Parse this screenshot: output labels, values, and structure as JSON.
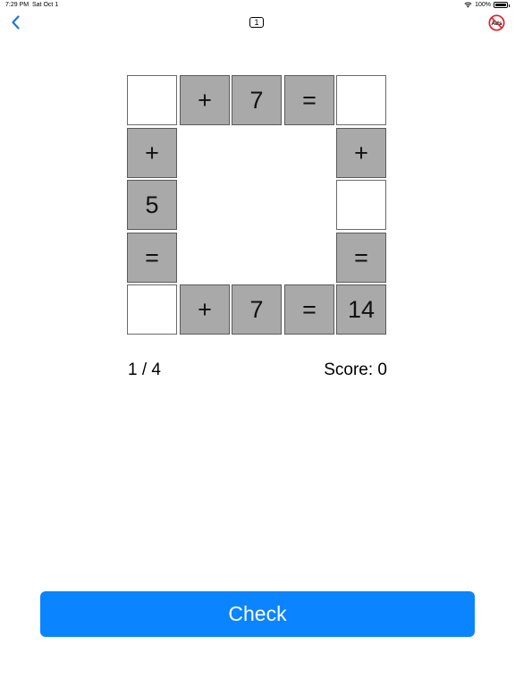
{
  "status_bar": {
    "time": "7:29 PM",
    "date": "Sat Oct 1",
    "battery": "100%"
  },
  "header": {
    "back_icon": "chevron-left-icon",
    "level": "1",
    "no_ads_icon": "no-ads-icon",
    "accent_color": "#1a73e8"
  },
  "puzzle": {
    "top_row": [
      "",
      "+",
      "7",
      "=",
      ""
    ],
    "left_col": [
      "+",
      "5",
      "="
    ],
    "right_col": [
      "+",
      "",
      "="
    ],
    "bottom_row": [
      "",
      "+",
      "7",
      "=",
      "14"
    ]
  },
  "footer": {
    "progress": "1 / 4",
    "score": "Score: 0"
  },
  "check_button": {
    "label": "Check",
    "color": "#0a84ff"
  }
}
